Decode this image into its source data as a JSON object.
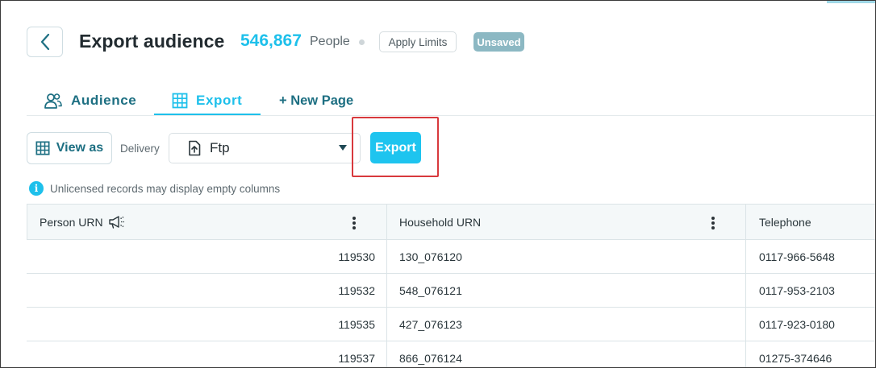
{
  "header": {
    "title": "Export audience",
    "count": "546,867",
    "count_unit": "People",
    "apply_limits_label": "Apply Limits",
    "status_badge": "Unsaved"
  },
  "tabs": [
    {
      "label": "Audience",
      "icon": "people-icon",
      "active": false
    },
    {
      "label": "Export",
      "icon": "grid-icon",
      "active": true
    },
    {
      "label": "+ New Page",
      "icon": "",
      "active": false
    }
  ],
  "toolbar": {
    "view_as_label": "View as",
    "delivery_label": "Delivery",
    "delivery_value": "Ftp",
    "export_label": "Export"
  },
  "info_note": "Unlicensed records may display empty columns",
  "table": {
    "columns": [
      "Person URN",
      "Household URN",
      "Telephone"
    ],
    "rows": [
      [
        "119530",
        "130_076120",
        "0117-966-5648"
      ],
      [
        "119532",
        "548_076121",
        "0117-953-2103"
      ],
      [
        "119535",
        "427_076123",
        "0117-923-0180"
      ],
      [
        "119537",
        "866_076124",
        "01275-374646"
      ]
    ]
  },
  "colors": {
    "accent": "#1ec0eb",
    "tab_text": "#1d6f82",
    "highlight": "#d8393d",
    "badge_bg": "#8cb8c3"
  }
}
